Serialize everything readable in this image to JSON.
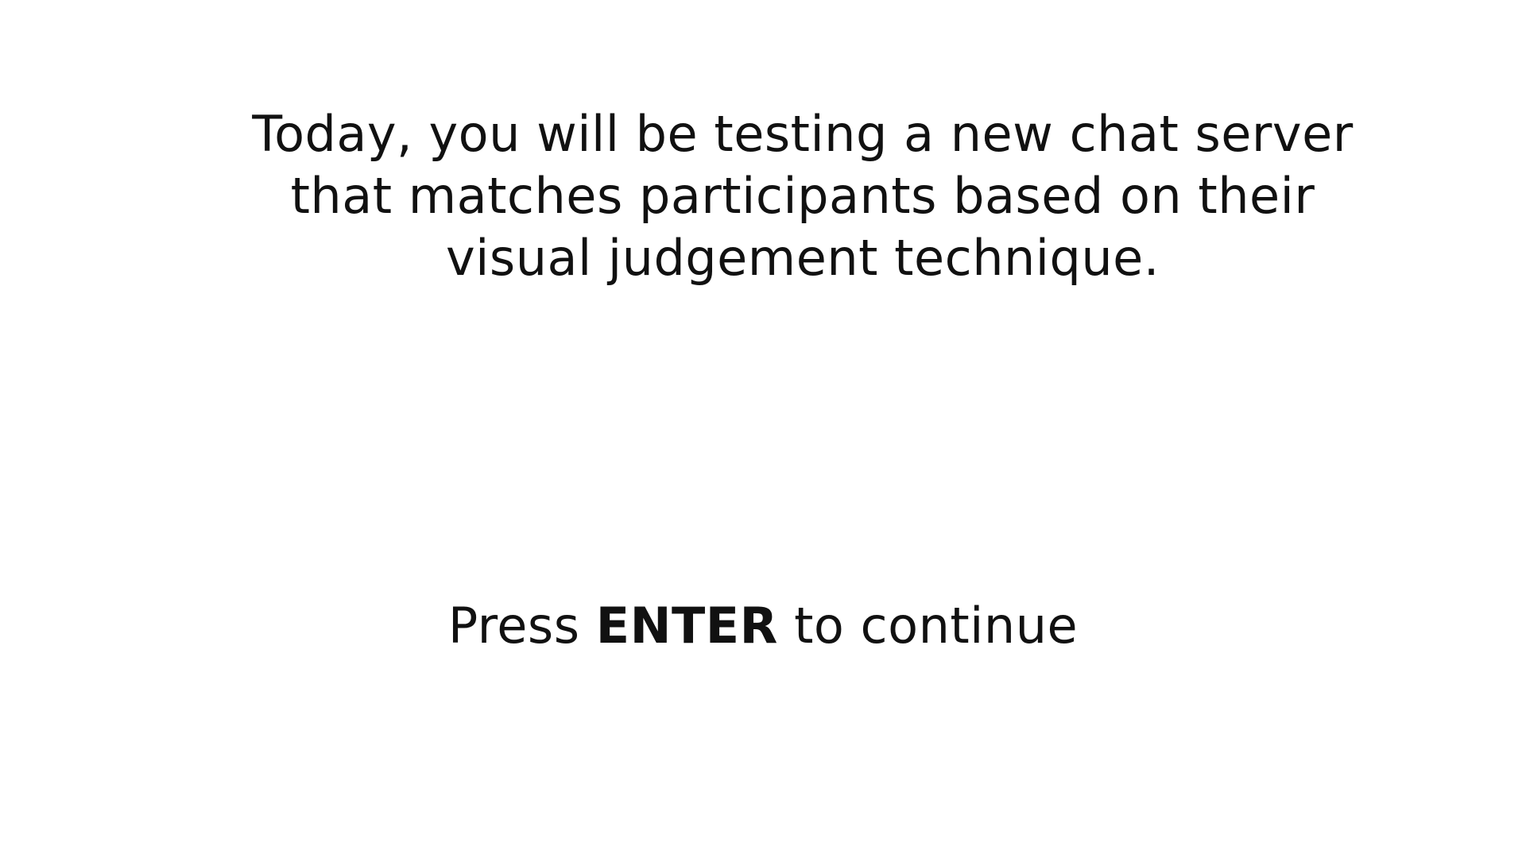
{
  "instruction": {
    "lines": [
      "Today, you will be testing a new chat server",
      "that matches participants based on their",
      "visual judgement technique."
    ]
  },
  "prompt": {
    "before": "Press ",
    "key": "ENTER",
    "after": " to continue"
  }
}
